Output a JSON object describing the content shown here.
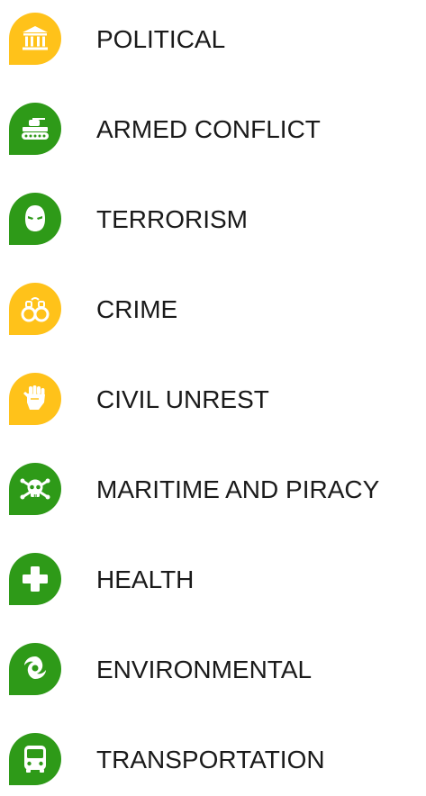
{
  "colors": {
    "yellow": "#ffc21a",
    "green": "#2e9a18",
    "glyph": "#ffffff",
    "text": "#1a1a1a"
  },
  "categories": [
    {
      "label": "POLITICAL",
      "icon": "government-building-icon",
      "color": "#ffc21a"
    },
    {
      "label": "ARMED CONFLICT",
      "icon": "tank-icon",
      "color": "#2e9a18"
    },
    {
      "label": "TERRORISM",
      "icon": "masked-head-icon",
      "color": "#2e9a18"
    },
    {
      "label": "CRIME",
      "icon": "handcuffs-icon",
      "color": "#ffc21a"
    },
    {
      "label": "CIVIL UNREST",
      "icon": "raised-fist-icon",
      "color": "#ffc21a"
    },
    {
      "label": "MARITIME AND PIRACY",
      "icon": "skull-crossbones-icon",
      "color": "#2e9a18"
    },
    {
      "label": "HEALTH",
      "icon": "plus-cross-icon",
      "color": "#2e9a18"
    },
    {
      "label": "ENVIRONMENTAL",
      "icon": "hurricane-icon",
      "color": "#2e9a18"
    },
    {
      "label": "TRANSPORTATION",
      "icon": "bus-icon",
      "color": "#2e9a18"
    }
  ]
}
